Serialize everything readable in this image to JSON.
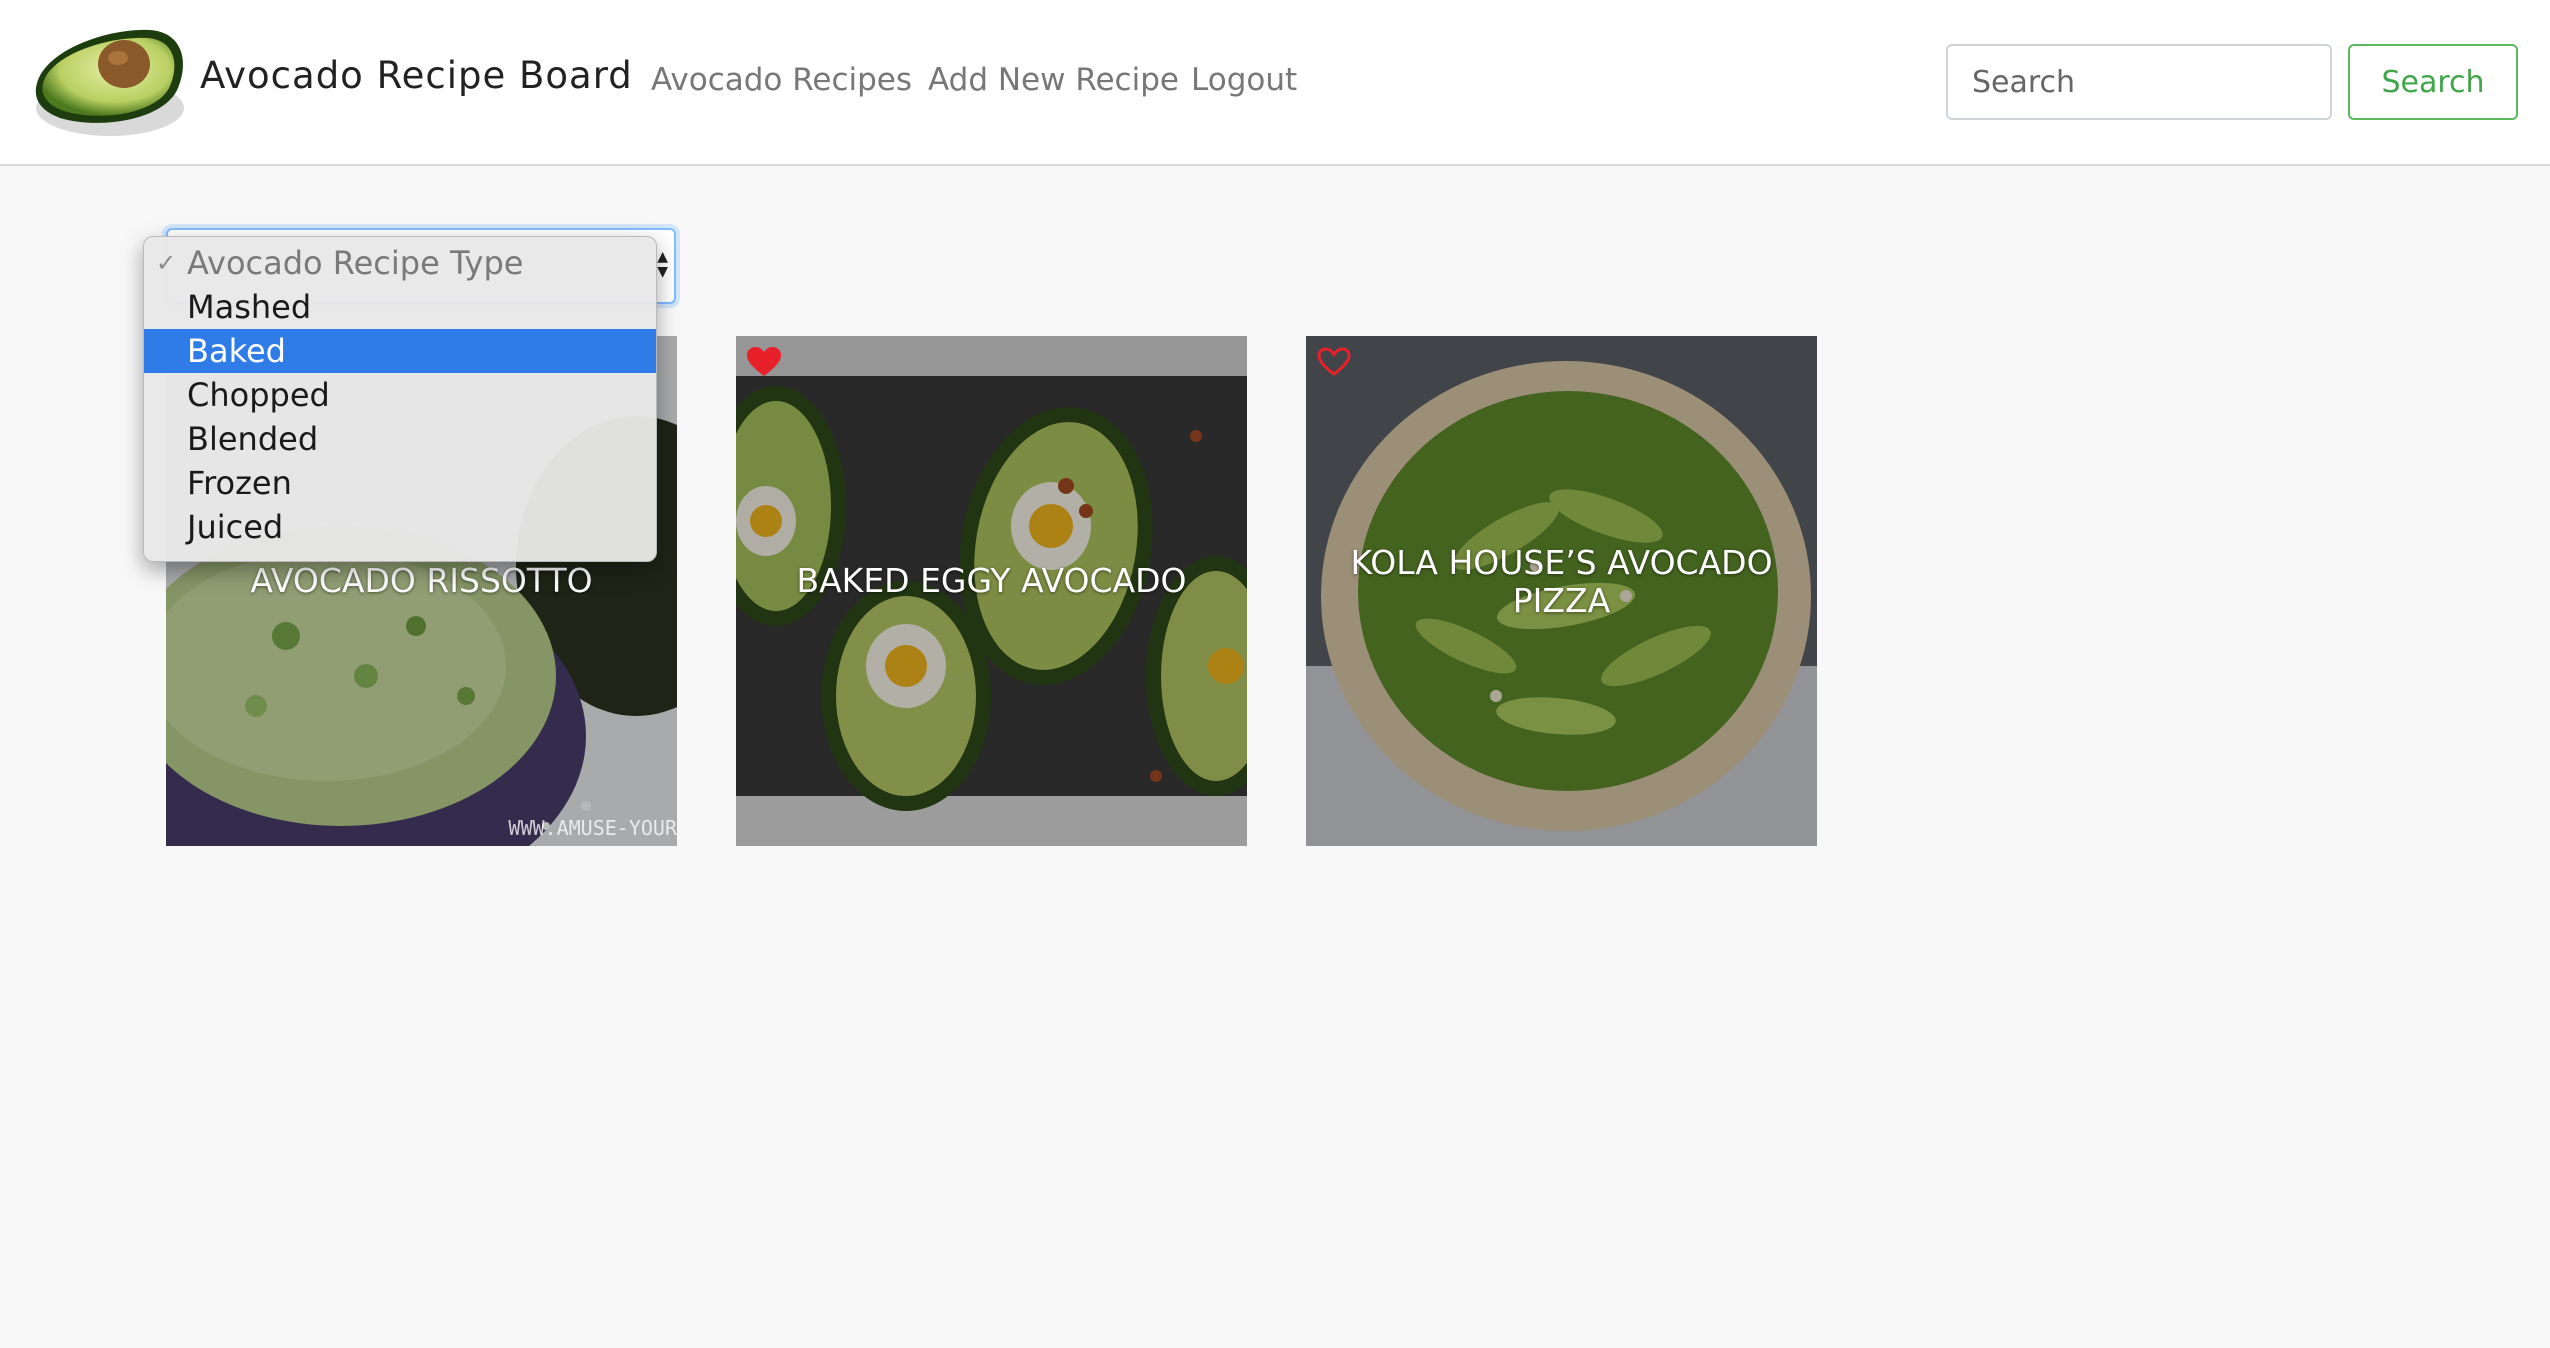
{
  "brand": {
    "name": "Avocado Recipe Board"
  },
  "nav": {
    "links": [
      "Avocado Recipes",
      "Add New Recipe",
      "Logout"
    ]
  },
  "search": {
    "placeholder": "Search",
    "button_label": "Search"
  },
  "recipe_type_select": {
    "options": [
      "Avocado Recipe Type",
      "Mashed",
      "Baked",
      "Chopped",
      "Blended",
      "Frozen",
      "Juiced"
    ],
    "checked_option": "Avocado Recipe Type",
    "highlighted_option": "Baked",
    "checkmark": "✓"
  },
  "cards": [
    {
      "title": "Avocado Rissotto",
      "favorite": null,
      "watermark": "WWW.AMUSE-YOUR"
    },
    {
      "title": "Baked Eggy Avocado",
      "favorite": true
    },
    {
      "title": "Kola House’s Avocado Pizza",
      "favorite": false
    }
  ],
  "colors": {
    "accent_green": "#3fa64a",
    "highlight_blue": "#2f7be8",
    "heart_red": "#e8202a",
    "page_bg": "#f8f8f8"
  }
}
